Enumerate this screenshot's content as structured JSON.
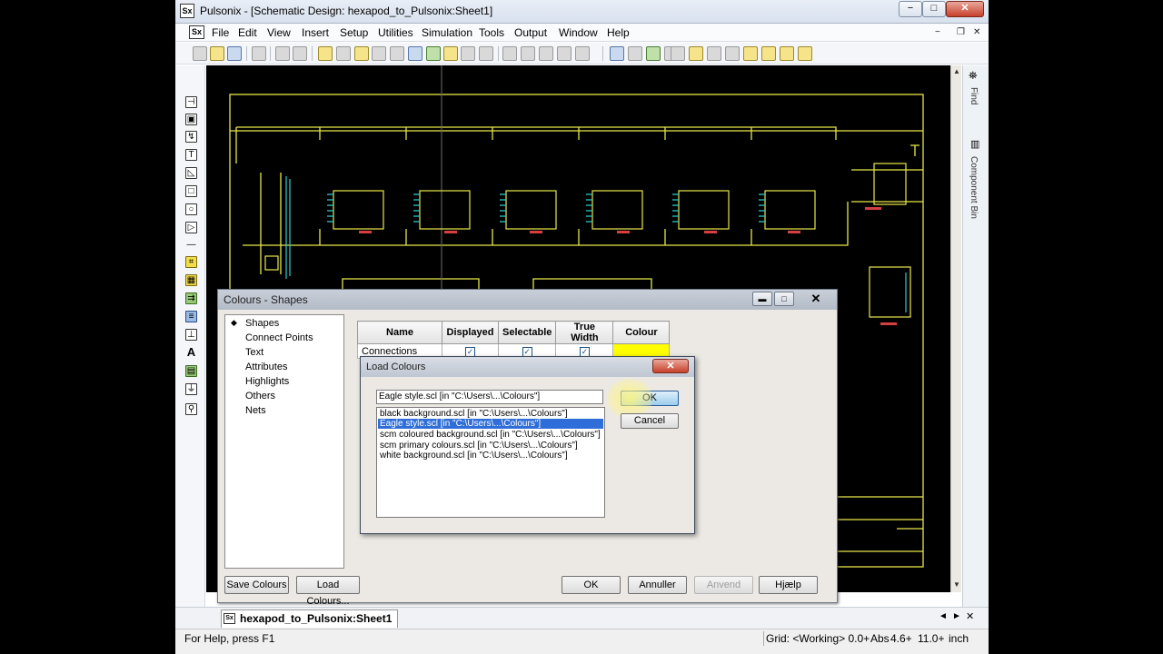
{
  "window": {
    "title": "Pulsonix - [Schematic Design: hexapod_to_Pulsonix:Sheet1]",
    "min_glyph": "−",
    "max_glyph": "□",
    "close_glyph": "✕"
  },
  "menu": {
    "items": [
      "File",
      "Edit",
      "View",
      "Insert",
      "Setup",
      "Utilities",
      "Simulation",
      "Tools",
      "Output",
      "Window",
      "Help"
    ],
    "mdi_min": "−",
    "mdi_restore": "❐",
    "mdi_close": "✕"
  },
  "side_panel": {
    "find_label": "Find",
    "component_bin_label": "Component Bin"
  },
  "colours_dialog": {
    "title": "Colours - Shapes",
    "tree": [
      "Shapes",
      "Connect Points",
      "Text",
      "Attributes",
      "Highlights",
      "Others",
      "Nets"
    ],
    "table": {
      "headers": [
        "Name",
        "Displayed",
        "Selectable",
        "True Width",
        "Colour"
      ],
      "rows": [
        {
          "name": "Connections",
          "displayed": true,
          "selectable": true,
          "true_width": true,
          "colour": "#ffff00"
        }
      ]
    },
    "buttons": {
      "save_colours": "Save Colours",
      "load_colours": "Load Colours...",
      "ok": "OK",
      "annuller": "Annuller",
      "anvend": "Anvend",
      "hjaelp": "Hjælp"
    }
  },
  "load_colours_dialog": {
    "title": "Load Colours",
    "close_glyph": "✕",
    "selected_file": "Eagle style.scl   [in \"C:\\Users\\...\\Colours\"]",
    "files": [
      "black background.scl   [in \"C:\\Users\\...\\Colours\"]",
      "Eagle style.scl   [in \"C:\\Users\\...\\Colours\"]",
      "scm coloured background.scl   [in \"C:\\Users\\...\\Colours\"]",
      "scm primary colours.scl   [in \"C:\\Users\\...\\Colours\"]",
      "white background.scl   [in \"C:\\Users\\...\\Colours\"]"
    ],
    "selected_index": 1,
    "ok": "OK",
    "cancel": "Cancel"
  },
  "document_tab": {
    "label": "hexapod_to_Pulsonix:Sheet1"
  },
  "status_bar": {
    "help": "For Help, press F1",
    "grid": "Grid: <Working> 0.0+",
    "abs": "Abs",
    "x": "4.6+",
    "y": "11.0+",
    "units": "inch"
  },
  "colors": {
    "schematic_line": "#e8e84a",
    "schematic_accent": "#d64040",
    "schematic_cyan": "#2ad0d0",
    "canvas_bg": "#000000"
  }
}
